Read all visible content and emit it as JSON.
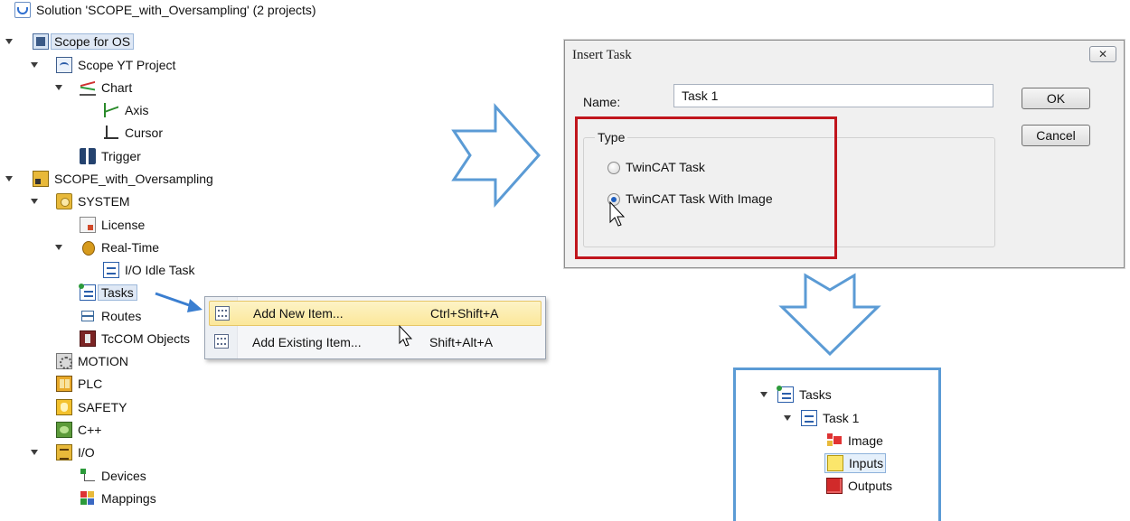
{
  "tree": {
    "solution_label": "Solution 'SCOPE_with_Oversampling' (2 projects)",
    "scope_project_label": "Scope for OS",
    "scope_yt_label": "Scope YT Project",
    "chart_label": "Chart",
    "axis_label": "Axis",
    "cursor_label": "Cursor",
    "trigger_label": "Trigger",
    "twincat_project_label": "SCOPE_with_Oversampling",
    "system_label": "SYSTEM",
    "license_label": "License",
    "realtime_label": "Real-Time",
    "io_idle_task_label": "I/O Idle Task",
    "tasks_label": "Tasks",
    "routes_label": "Routes",
    "tcom_label": "TcCOM Objects",
    "motion_label": "MOTION",
    "plc_label": "PLC",
    "safety_label": "SAFETY",
    "cpp_label": "C++",
    "io_label": "I/O",
    "devices_label": "Devices",
    "mappings_label": "Mappings"
  },
  "context_menu": {
    "items": [
      {
        "label": "Add New Item...",
        "shortcut": "Ctrl+Shift+A"
      },
      {
        "label": "Add Existing Item...",
        "shortcut": "Shift+Alt+A"
      }
    ]
  },
  "dialog": {
    "title": "Insert Task",
    "close_glyph": "✕",
    "name_label": "Name:",
    "name_value": "Task 1",
    "ok_label": "OK",
    "cancel_label": "Cancel",
    "type_legend": "Type",
    "option_twincat_task": "TwinCAT Task",
    "option_twincat_task_image": "TwinCAT Task With Image",
    "selected_option": "TwinCAT Task With Image"
  },
  "result_tree": {
    "tasks_label": "Tasks",
    "task1_label": "Task 1",
    "image_label": "Image",
    "inputs_label": "Inputs",
    "outputs_label": "Outputs"
  },
  "colors": {
    "highlight_box": "#c0151c",
    "result_box": "#5b9bd5",
    "arrow": "#5b9bd5"
  }
}
